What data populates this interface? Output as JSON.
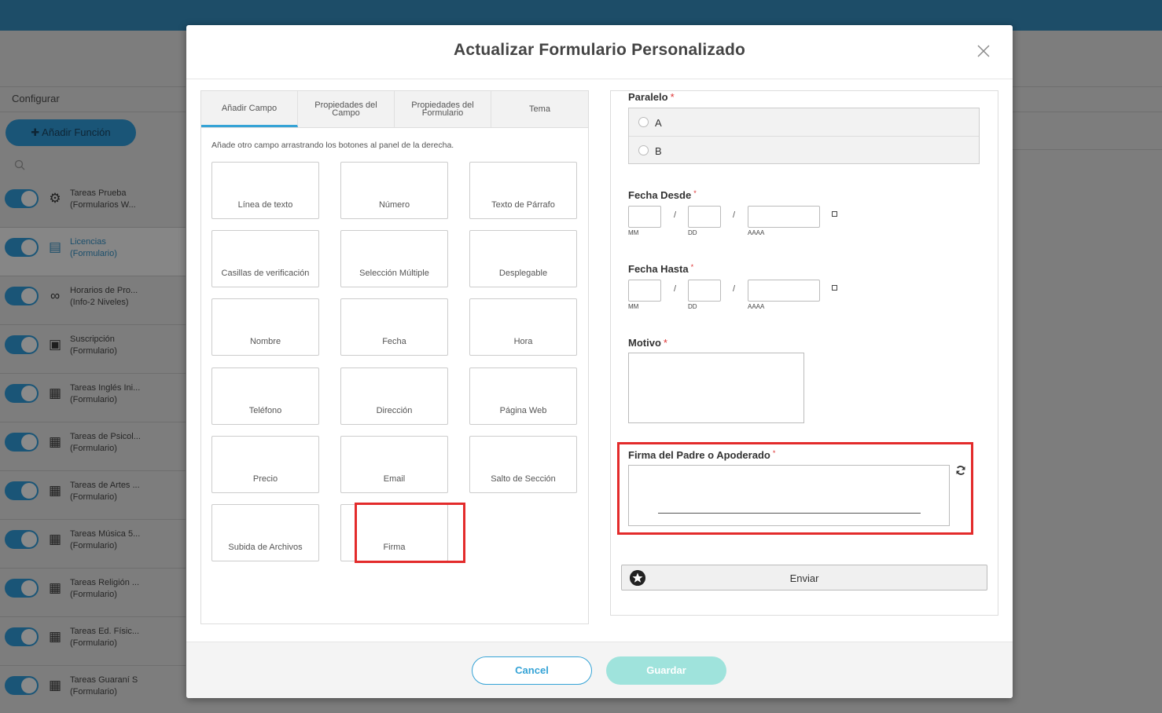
{
  "background": {
    "config_label": "Configurar",
    "add_function_label": "✚ Añadir Función",
    "sidebar_items": [
      {
        "line1": "Tareas Prueba",
        "line2": "(Formularios W...",
        "icon": "gear-icon"
      },
      {
        "line1": "Licencias",
        "line2": "(Formulario)",
        "icon": "document-icon"
      },
      {
        "line1": "Horarios de Pro...",
        "line2": "(Info-2 Niveles)",
        "icon": "glasses-icon"
      },
      {
        "line1": "Suscripción",
        "line2": "(Formulario)",
        "icon": "id-card-icon"
      },
      {
        "line1": "Tareas Inglés Ini...",
        "line2": "(Formulario)",
        "icon": "classroom-icon"
      },
      {
        "line1": "Tareas de Psicol...",
        "line2": "(Formulario)",
        "icon": "classroom-icon"
      },
      {
        "line1": "Tareas de Artes ...",
        "line2": "(Formulario)",
        "icon": "classroom-icon"
      },
      {
        "line1": "Tareas Música 5...",
        "line2": "(Formulario)",
        "icon": "classroom-icon"
      },
      {
        "line1": "Tareas Religión ...",
        "line2": "(Formulario)",
        "icon": "classroom-icon"
      },
      {
        "line1": "Tareas Ed. Físic...",
        "line2": "(Formulario)",
        "icon": "classroom-icon"
      },
      {
        "line1": "Tareas Guaraní S",
        "line2": "(Formulario)",
        "icon": "classroom-icon"
      }
    ]
  },
  "modal": {
    "title": "Actualizar Formulario Personalizado",
    "tabs": [
      "Añadir Campo",
      "Propiedades del Campo",
      "Propiedades del Formulario",
      "Tema"
    ],
    "hint": "Añade otro campo arrastrando los botones al panel de la derecha.",
    "field_buttons": [
      "Línea de texto",
      "Número",
      "Texto de Párrafo",
      "Casillas de verificación",
      "Selección Múltiple",
      "Desplegable",
      "Nombre",
      "Fecha",
      "Hora",
      "Teléfono",
      "Dirección",
      "Página Web",
      "Precio",
      "Email",
      "Salto de Sección",
      "Subida de Archivos",
      "Firma"
    ],
    "preview": {
      "paralelo_label": "Paralelo",
      "paralelo_options": [
        "A",
        "B"
      ],
      "fecha_desde_label": "Fecha Desde",
      "fecha_hasta_label": "Fecha Hasta",
      "date_captions": [
        "MM",
        "DD",
        "AAAA"
      ],
      "date_separator": "/",
      "motivo_label": "Motivo",
      "firma_label": "Firma del Padre o Apoderado",
      "required_mark": "*",
      "submit_label": "Enviar"
    },
    "footer": {
      "cancel_label": "Cancel",
      "save_label": "Guardar"
    }
  },
  "colors": {
    "topbar": "#1d4d68",
    "accent": "#35a3d6",
    "highlight": "#e32b2b",
    "save_disabled": "#9fe3dc"
  }
}
